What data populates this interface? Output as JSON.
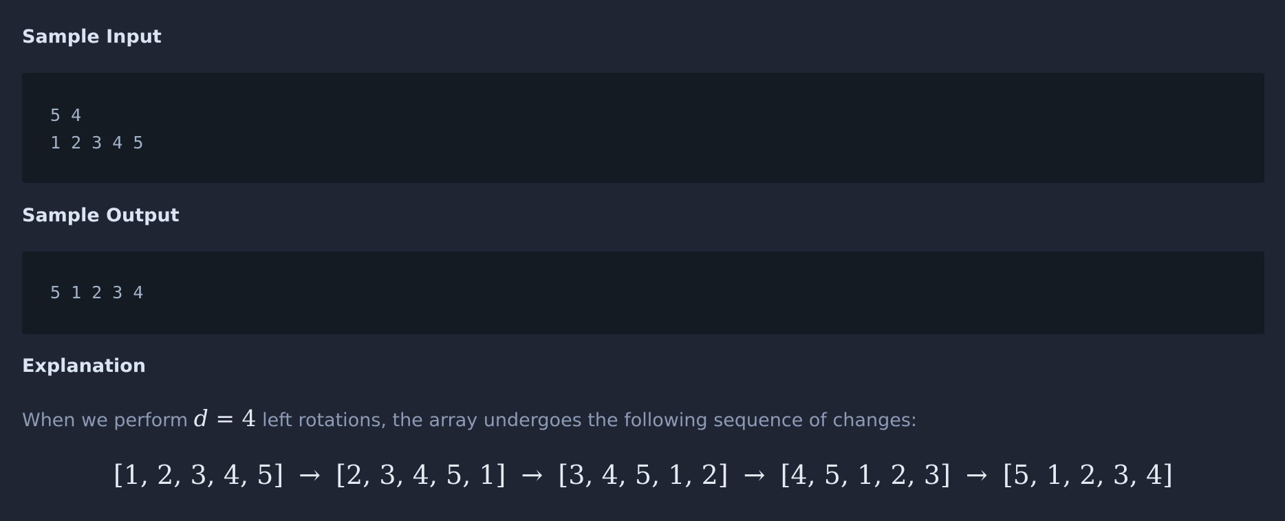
{
  "sample_input": {
    "heading": "Sample Input",
    "lines": [
      "5 4",
      "1 2 3 4 5"
    ]
  },
  "sample_output": {
    "heading": "Sample Output",
    "lines": [
      "5 1 2 3 4"
    ]
  },
  "explanation": {
    "heading": "Explanation",
    "text_before": "When we perform ",
    "math_var": "d",
    "math_rest": " = 4",
    "text_after": " left rotations, the array undergoes the following sequence of changes:",
    "sequence": [
      "[1, 2, 3, 4, 5]",
      "[2, 3, 4, 5, 1]",
      "[3, 4, 5, 1, 2]",
      "[4, 5, 1, 2, 3]",
      "[5, 1, 2, 3, 4]"
    ],
    "arrow": "→"
  },
  "colors": {
    "page_background": "#1f2532",
    "code_background": "#151b23",
    "heading_text": "#dbe4f3",
    "body_text": "#8d9bb7",
    "code_text": "#a2b2c8",
    "math_text": "#e6ebf3"
  }
}
